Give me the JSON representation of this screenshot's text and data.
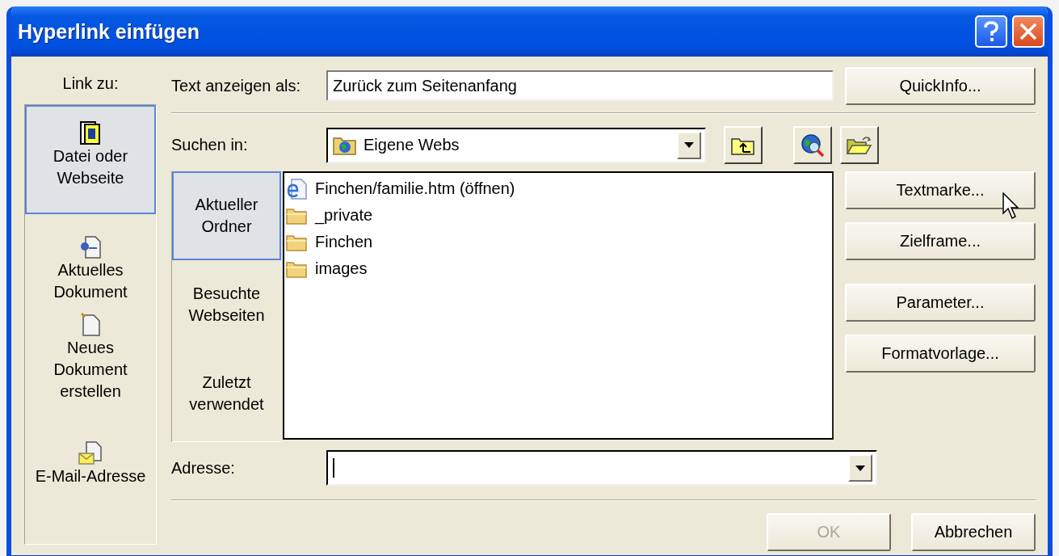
{
  "window": {
    "title": "Hyperlink einfügen"
  },
  "link_to": {
    "label": "Link zu:",
    "items": [
      {
        "label": "Datei oder Webseite",
        "selected": true
      },
      {
        "label": "Aktuelles Dokument",
        "selected": false
      },
      {
        "label": "Neues Dokument erstellen",
        "selected": false
      },
      {
        "label": "E-Mail-Adresse",
        "selected": false
      }
    ]
  },
  "display_text": {
    "label": "Text anzeigen als:",
    "value": "Zurück zum Seitenanfang"
  },
  "look_in": {
    "label": "Suchen in:",
    "value": "Eigene Webs"
  },
  "places": [
    {
      "label": "Aktueller Ordner",
      "selected": true
    },
    {
      "label": "Besuchte Webseiten",
      "selected": false
    },
    {
      "label": "Zuletzt verwendet",
      "selected": false
    }
  ],
  "files": [
    {
      "kind": "web-page",
      "name": "Finchen/familie.htm (öffnen)"
    },
    {
      "kind": "folder",
      "name": "_private"
    },
    {
      "kind": "folder",
      "name": "Finchen"
    },
    {
      "kind": "folder",
      "name": "images"
    }
  ],
  "address": {
    "label": "Adresse:"
  },
  "side_buttons": [
    {
      "label": "QuickInfo..."
    },
    {
      "label": "Textmarke..."
    },
    {
      "label": "Zielframe..."
    },
    {
      "label": "Parameter..."
    },
    {
      "label": "Formatvorlage..."
    }
  ],
  "footer_buttons": [
    {
      "label": "OK",
      "disabled": true
    },
    {
      "label": "Abbrechen",
      "disabled": false
    }
  ]
}
